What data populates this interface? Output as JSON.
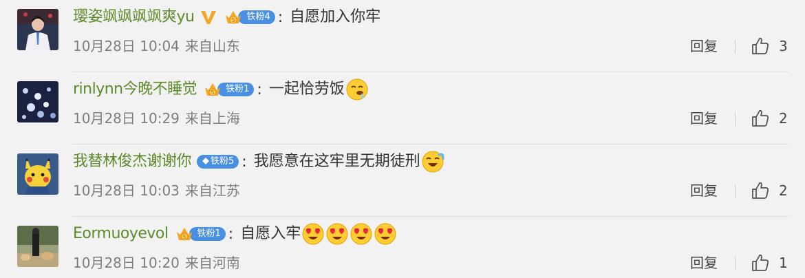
{
  "comments": [
    {
      "username": "璎姿飒飒飒飒爽yu",
      "verified": true,
      "fan_badge": {
        "level_icon": "crown",
        "label": "铁粉4"
      },
      "colon": ":",
      "text": "自愿加入你牢",
      "emojis": [],
      "date": "10月28日 10:04",
      "location": "来自山东",
      "reply_label": "回复",
      "likes": "3"
    },
    {
      "username": "rinlynn今晚不睡觉",
      "verified": false,
      "fan_badge": {
        "level_icon": "crown",
        "label": "铁粉1"
      },
      "colon": ":",
      "text": "一起恰劳饭",
      "emojis": [
        "drooling-face-emoji"
      ],
      "date": "10月28日 10:29",
      "location": "来自上海",
      "reply_label": "回复",
      "likes": "2"
    },
    {
      "username": "我替林俊杰谢谢你",
      "verified": false,
      "fan_badge": {
        "level_icon": "diamond",
        "label": "铁粉5"
      },
      "colon": ":",
      "text": "我愿意在这牢里无期徒刑",
      "emojis": [
        "crying-laughing-emoji"
      ],
      "date": "10月28日 10:03",
      "location": "来自江苏",
      "reply_label": "回复",
      "likes": "2"
    },
    {
      "username": "Eormuoyevol",
      "verified": false,
      "fan_badge": {
        "level_icon": "crown",
        "label": "铁粉1"
      },
      "colon": ":",
      "text": "自愿入牢",
      "emojis": [
        "heart-eyes-emoji",
        "heart-eyes-emoji",
        "heart-eyes-emoji",
        "heart-eyes-emoji"
      ],
      "date": "10月28日 10:20",
      "location": "来自河南",
      "reply_label": "回复",
      "likes": "1"
    }
  ],
  "colors": {
    "background": "#f2f2f2",
    "username": "#5e8a2a",
    "fan_badge": "#4a90e2",
    "verified": "#f5a623",
    "meta": "#7d7d7d"
  }
}
